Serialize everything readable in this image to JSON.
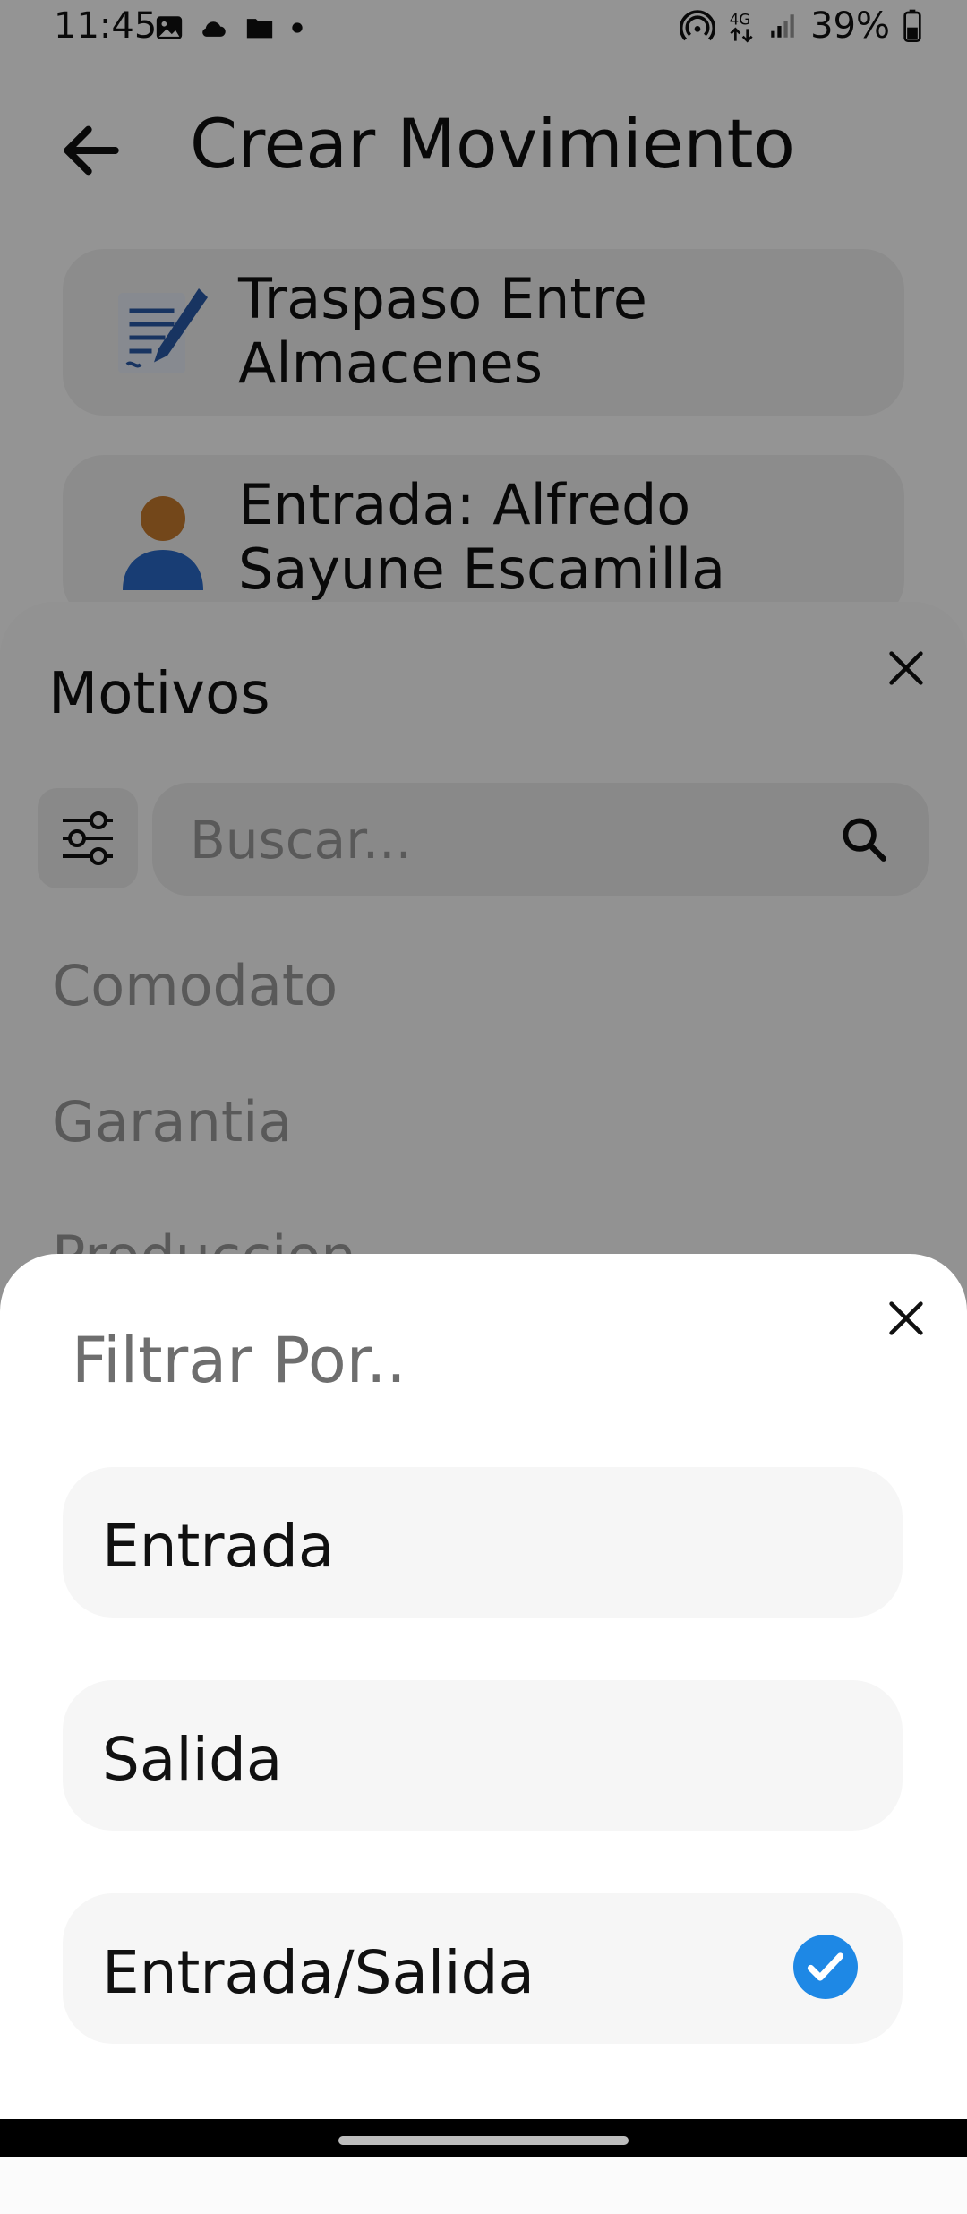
{
  "status_bar": {
    "time": "11:45",
    "battery": "39%"
  },
  "header": {
    "title": "Crear Movimiento"
  },
  "cards": [
    {
      "label": "Traspaso Entre Almacenes"
    },
    {
      "label": "Entrada: Alfredo Sayune Escamilla"
    }
  ],
  "motivos_sheet": {
    "title": "Motivos",
    "search_placeholder": "Buscar...",
    "items": [
      {
        "label": "Comodato"
      },
      {
        "label": "Garantia"
      },
      {
        "label": "Produccion"
      }
    ]
  },
  "filter_sheet": {
    "title": "Filtrar Por..",
    "options": [
      {
        "label": "Entrada",
        "selected": false
      },
      {
        "label": "Salida",
        "selected": false
      },
      {
        "label": "Entrada/Salida",
        "selected": true
      }
    ]
  },
  "colors": {
    "accent": "#1e88e5"
  }
}
